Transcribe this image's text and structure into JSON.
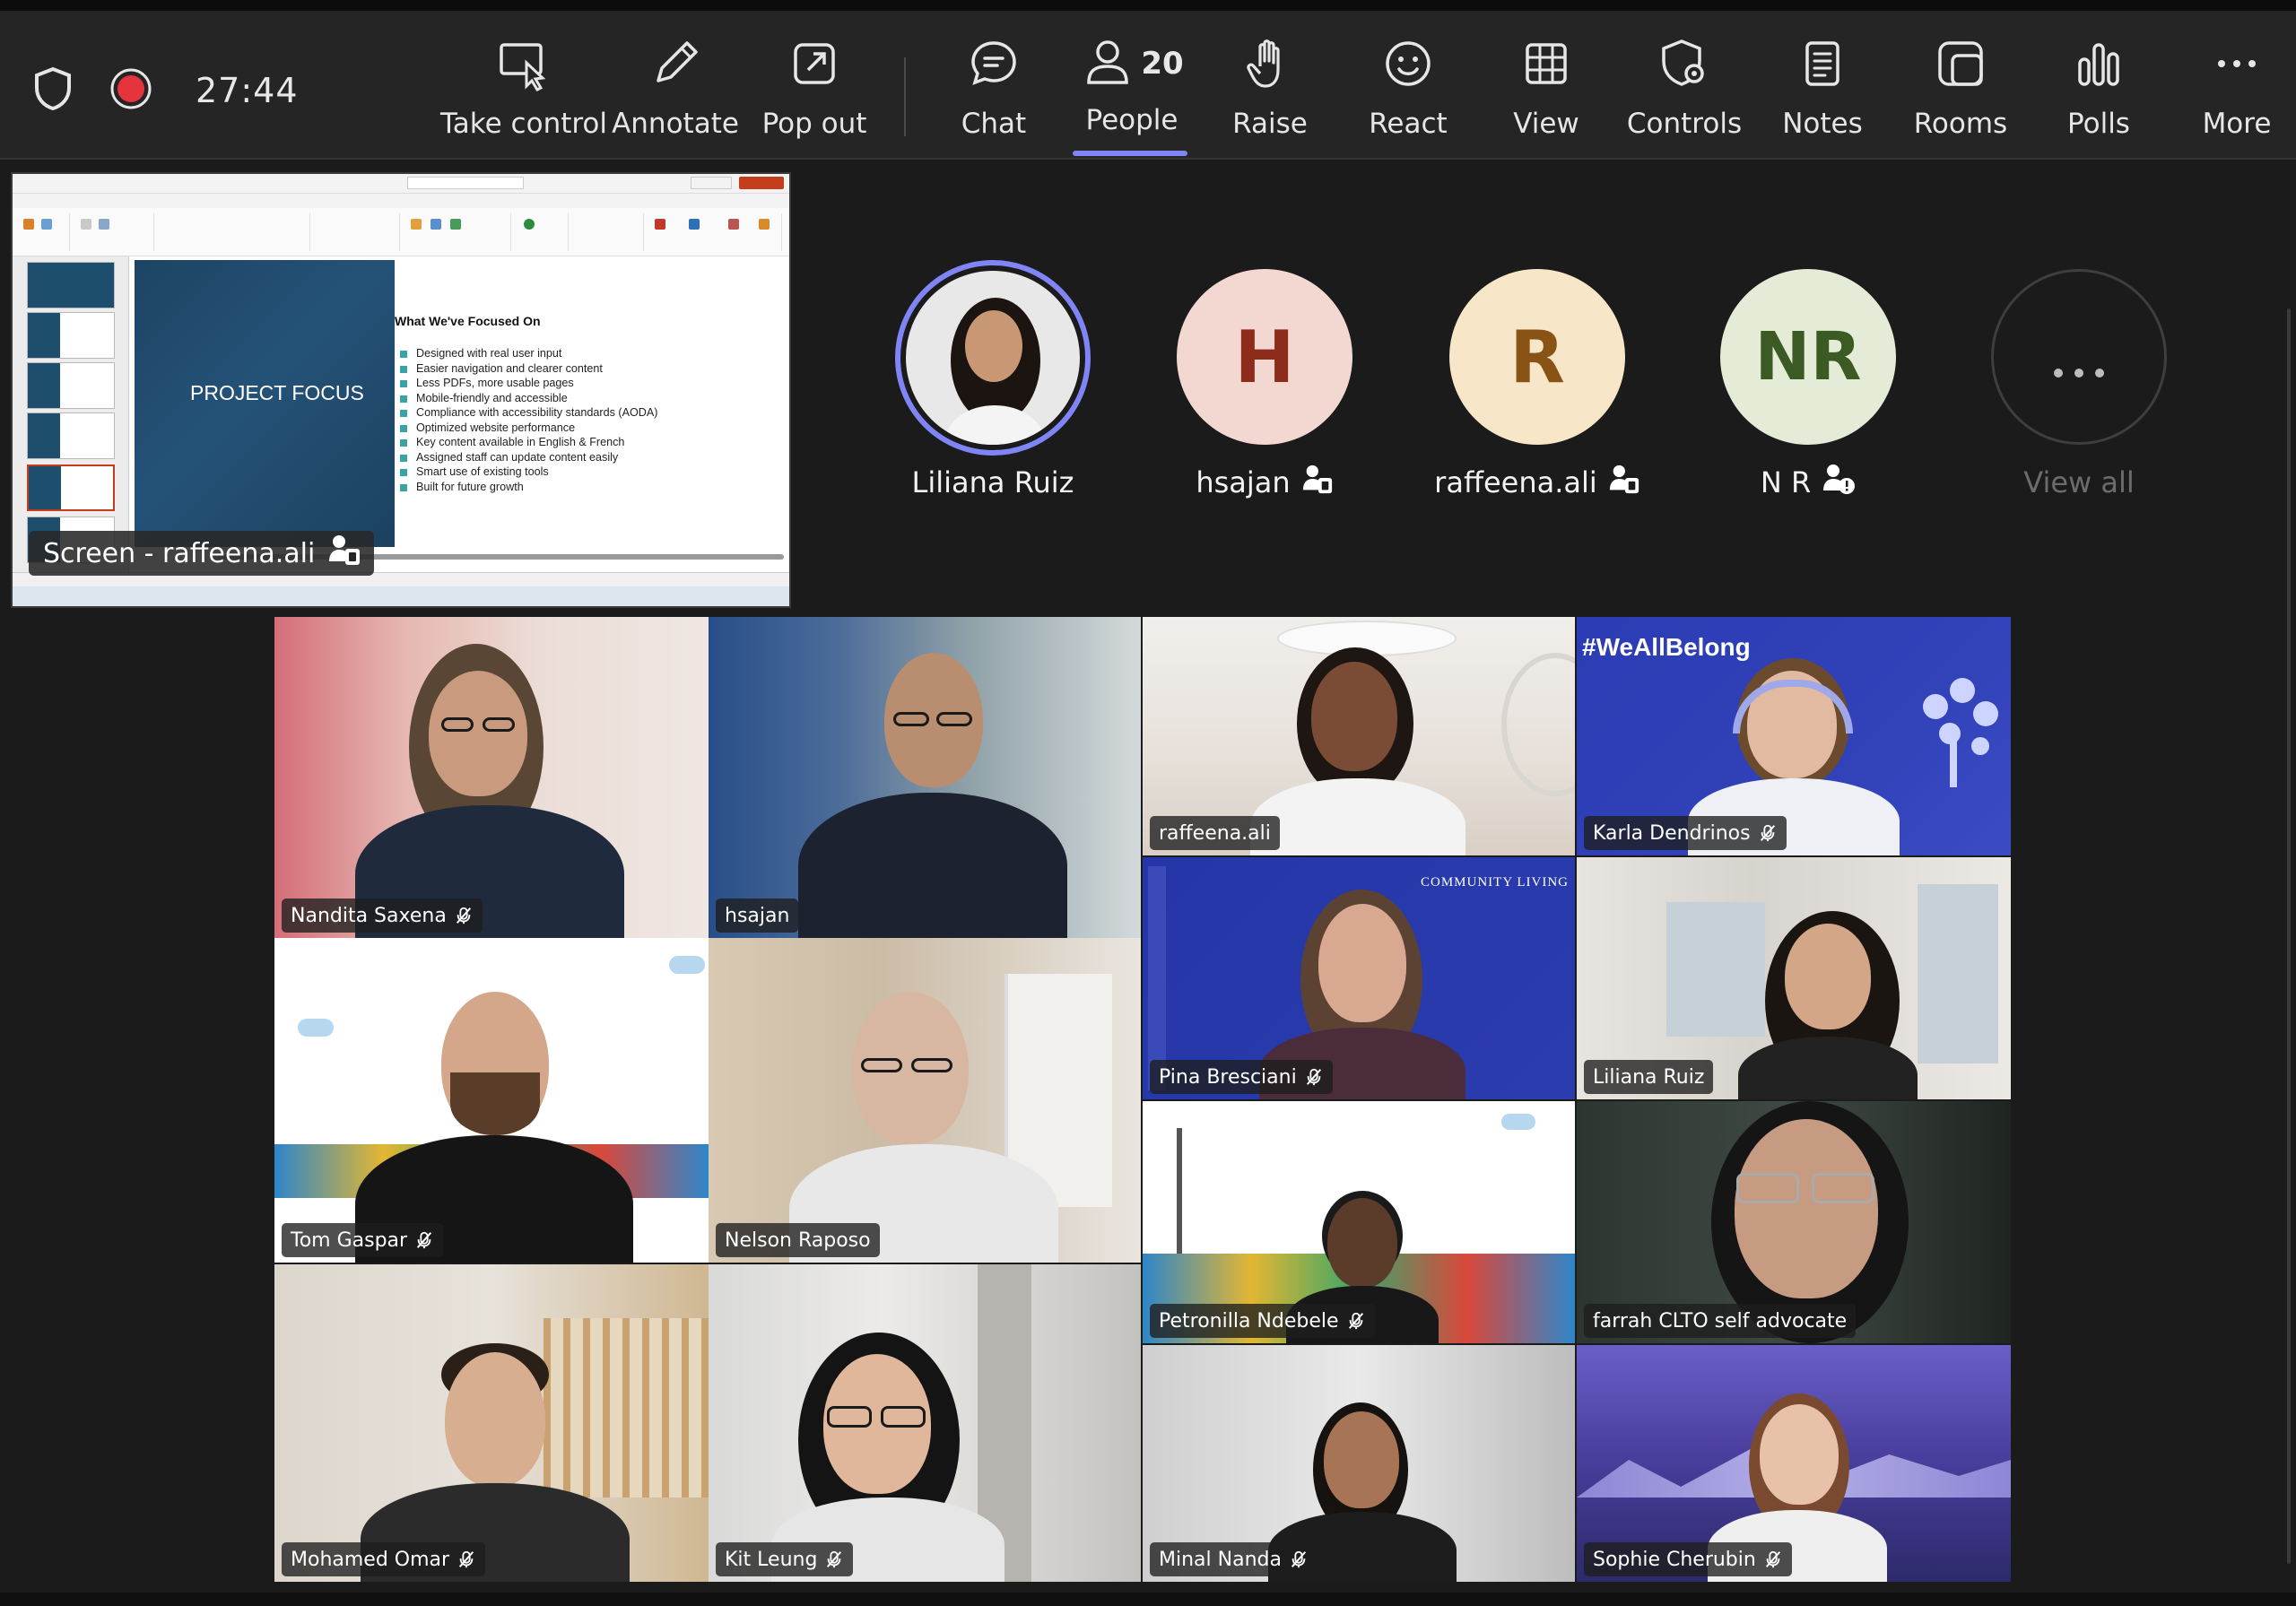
{
  "call": {
    "timer": "27:44"
  },
  "toolbar": {
    "take_control": "Take control",
    "annotate": "Annotate",
    "pop_out": "Pop out",
    "chat": "Chat",
    "people": "People",
    "people_count": "20",
    "raise": "Raise",
    "react": "React",
    "view": "View",
    "controls": "Controls",
    "notes": "Notes",
    "rooms": "Rooms",
    "polls": "Polls",
    "more": "More"
  },
  "share": {
    "label": "Screen - raffeena.ali",
    "slide": {
      "panel_title": "PROJECT FOCUS",
      "heading": "What We've Focused On",
      "bullets": [
        "Designed with real user input",
        "Easier navigation and clearer content",
        "Less PDFs, more usable pages",
        "Mobile-friendly and accessible",
        "Compliance with accessibility standards (AODA)",
        "Optimized website performance",
        "Key content available in English & French",
        "Assigned staff can update content easily",
        "Smart use of existing tools",
        "Built for future growth"
      ]
    }
  },
  "spotlight": [
    {
      "name": "Liliana Ruiz",
      "initials": ""
    },
    {
      "name": "hsajan",
      "initials": "H"
    },
    {
      "name": "raffeena.ali",
      "initials": "R"
    },
    {
      "name": "N R",
      "initials": "NR"
    },
    {
      "name": "View all",
      "initials": ""
    }
  ],
  "tiles": [
    {
      "name": "Nandita Saxena",
      "muted": true
    },
    {
      "name": "hsajan",
      "muted": false
    },
    {
      "name": "raffeena.ali",
      "muted": false
    },
    {
      "name": "Karla Dendrinos",
      "muted": true,
      "banner": "#WeAllBelong"
    },
    {
      "name": "Pina Bresciani",
      "muted": true,
      "banner": "COMMUNITY LIVING"
    },
    {
      "name": "Liliana Ruiz",
      "muted": false
    },
    {
      "name": "Tom Gaspar",
      "muted": true
    },
    {
      "name": "Nelson Raposo",
      "muted": false
    },
    {
      "name": "Petronilla Ndebele",
      "muted": true
    },
    {
      "name": "farrah CLTO self advocate",
      "muted": false
    },
    {
      "name": "Mohamed Omar",
      "muted": true
    },
    {
      "name": "Kit Leung",
      "muted": true
    },
    {
      "name": "Minal Nanda",
      "muted": true
    },
    {
      "name": "Sophie Cherubin",
      "muted": true
    }
  ]
}
